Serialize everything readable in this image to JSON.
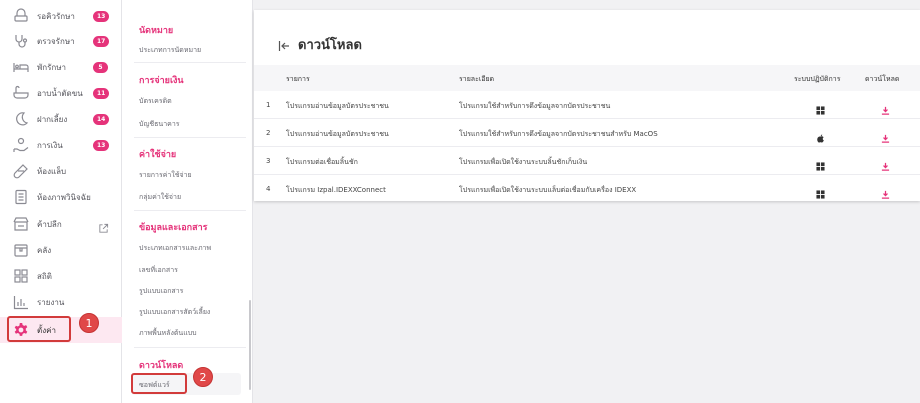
{
  "sidebar": {
    "items": [
      {
        "label": "รอคิวรักษา",
        "icon": "queue-icon",
        "badge": "13"
      },
      {
        "label": "ตรวจรักษา",
        "icon": "stethoscope-icon",
        "badge": "17"
      },
      {
        "label": "พักรักษา",
        "icon": "bed-icon",
        "badge": "5"
      },
      {
        "label": "อาบน้ำตัดขน",
        "icon": "bathtub-icon",
        "badge": "11"
      },
      {
        "label": "ฝากเลี้ยง",
        "icon": "moon-icon",
        "badge": "14"
      },
      {
        "label": "การเงิน",
        "icon": "payment-hand-icon",
        "badge": "13"
      },
      {
        "label": "ห้องแล็บ",
        "icon": "test-tube-icon",
        "badge": ""
      },
      {
        "label": "ห้องภาพวินิจฉัย",
        "icon": "xray-icon",
        "badge": ""
      },
      {
        "label": "ค้าปลีก",
        "icon": "store-icon",
        "badge": ""
      },
      {
        "label": "คลัง",
        "icon": "box-icon",
        "badge": ""
      },
      {
        "label": "สถิติ",
        "icon": "grid-icon",
        "badge": ""
      },
      {
        "label": "รายงาน",
        "icon": "bar-chart-icon",
        "badge": ""
      },
      {
        "label": "ตั้งค่า",
        "icon": "gear-icon",
        "badge": "",
        "active": true
      }
    ],
    "step1": "1"
  },
  "menu": {
    "sections": [
      {
        "title": "นัดหมาย",
        "items": [
          "ประเภทการนัดหมาย"
        ]
      },
      {
        "title": "การจ่ายเงิน",
        "items": [
          "บัตรเครดิต",
          "บัญชีธนาคาร"
        ]
      },
      {
        "title": "ค่าใช้จ่าย",
        "items": [
          "รายการค่าใช้จ่าย",
          "กลุ่มค่าใช้จ่าย"
        ]
      },
      {
        "title": "ข้อมูลและเอกสาร",
        "items": [
          "ประเภทเอกสารและภาพ",
          "เลขที่เอกสาร",
          "รูปแบบเอกสาร",
          "รูปแบบเอกสารสัตว์เลี้ยง",
          "ภาพพื้นหลังต้นแบบ"
        ]
      },
      {
        "title": "ดาวน์โหลด",
        "items": [
          "ซอฟต์แวร์"
        ]
      }
    ],
    "step2": "2"
  },
  "page": {
    "title": "ดาวน์โหลด",
    "columns": {
      "item": "รายการ",
      "detail": "รายละเอียด",
      "os": "ระบบปฏิบัติการ",
      "download": "ดาวน์โหลด"
    },
    "rows": [
      {
        "no": "1",
        "name": "โปรแกรมอ่านข้อมูลบัตรประชาชน",
        "detail": "โปรแกรมใช้สำหรับการดึงข้อมูลจากบัตรประชาชน",
        "os": "windows-icon"
      },
      {
        "no": "2",
        "name": "โปรแกรมอ่านข้อมูลบัตรประชาชน",
        "detail": "โปรแกรมใช้สำหรับการดึงข้อมูลจากบัตรประชาชนสำหรับ MacOS",
        "os": "apple-icon"
      },
      {
        "no": "3",
        "name": "โปรแกรมต่อเชื่อมลิ้นชัก",
        "detail": "โปรแกรมเพื่อเปิดใช้งานระบบลิ้นชักเก็บเงิน",
        "os": "windows-icon"
      },
      {
        "no": "4",
        "name": "โปรแกรม Izpal.IDEXXConnect",
        "detail": "โปรแกรมเพื่อเปิดใช้งานระบบแล็บต่อเชื่อมกับเครื่อง IDEXX",
        "os": "windows-icon"
      }
    ]
  },
  "colors": {
    "accent": "#e5337a",
    "highlight": "#d23b3b"
  }
}
